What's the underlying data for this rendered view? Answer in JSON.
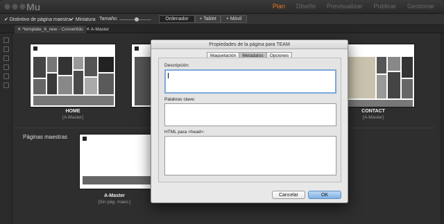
{
  "app": {
    "name": "Mu"
  },
  "modes": [
    {
      "label": "Plan",
      "active": true
    },
    {
      "label": "Diseño",
      "active": false
    },
    {
      "label": "Previsualizar",
      "active": false
    },
    {
      "label": "Publicar",
      "active": false
    },
    {
      "label": "Gestionar",
      "active": false
    }
  ],
  "options": {
    "check1": "Distintivo de página maestra",
    "check2": "Miniatura",
    "size_label": "Tamaño:",
    "views": [
      "Ordenador",
      "+ Tablet",
      "+ Móvil"
    ],
    "selected_view": "Ordenador"
  },
  "tabs": [
    {
      "label": "*template_6_new - Convertido",
      "active": true
    },
    {
      "label": "A-Master",
      "active": false
    }
  ],
  "pages": [
    {
      "name": "HOME",
      "master": "[A-Master]"
    },
    {
      "name": "CONTACT",
      "master": "[A-Master]"
    }
  ],
  "masters_section": "Páginas maestras",
  "master_page": {
    "name": "A-Master",
    "sub": "[Sin pág. maes.]"
  },
  "dialog": {
    "title": "Propiedades de la página para TEAM",
    "tabs": [
      "Maquetación",
      "Metadatos",
      "Opciones"
    ],
    "selected_tab": "Metadatos",
    "description_label": "Descripción:",
    "description_value": "",
    "keywords_label": "Palabras clave:",
    "keywords_value": "",
    "head_label": "HTML para <head>:",
    "head_value": "",
    "cancel": "Cancelar",
    "ok": "OK"
  }
}
